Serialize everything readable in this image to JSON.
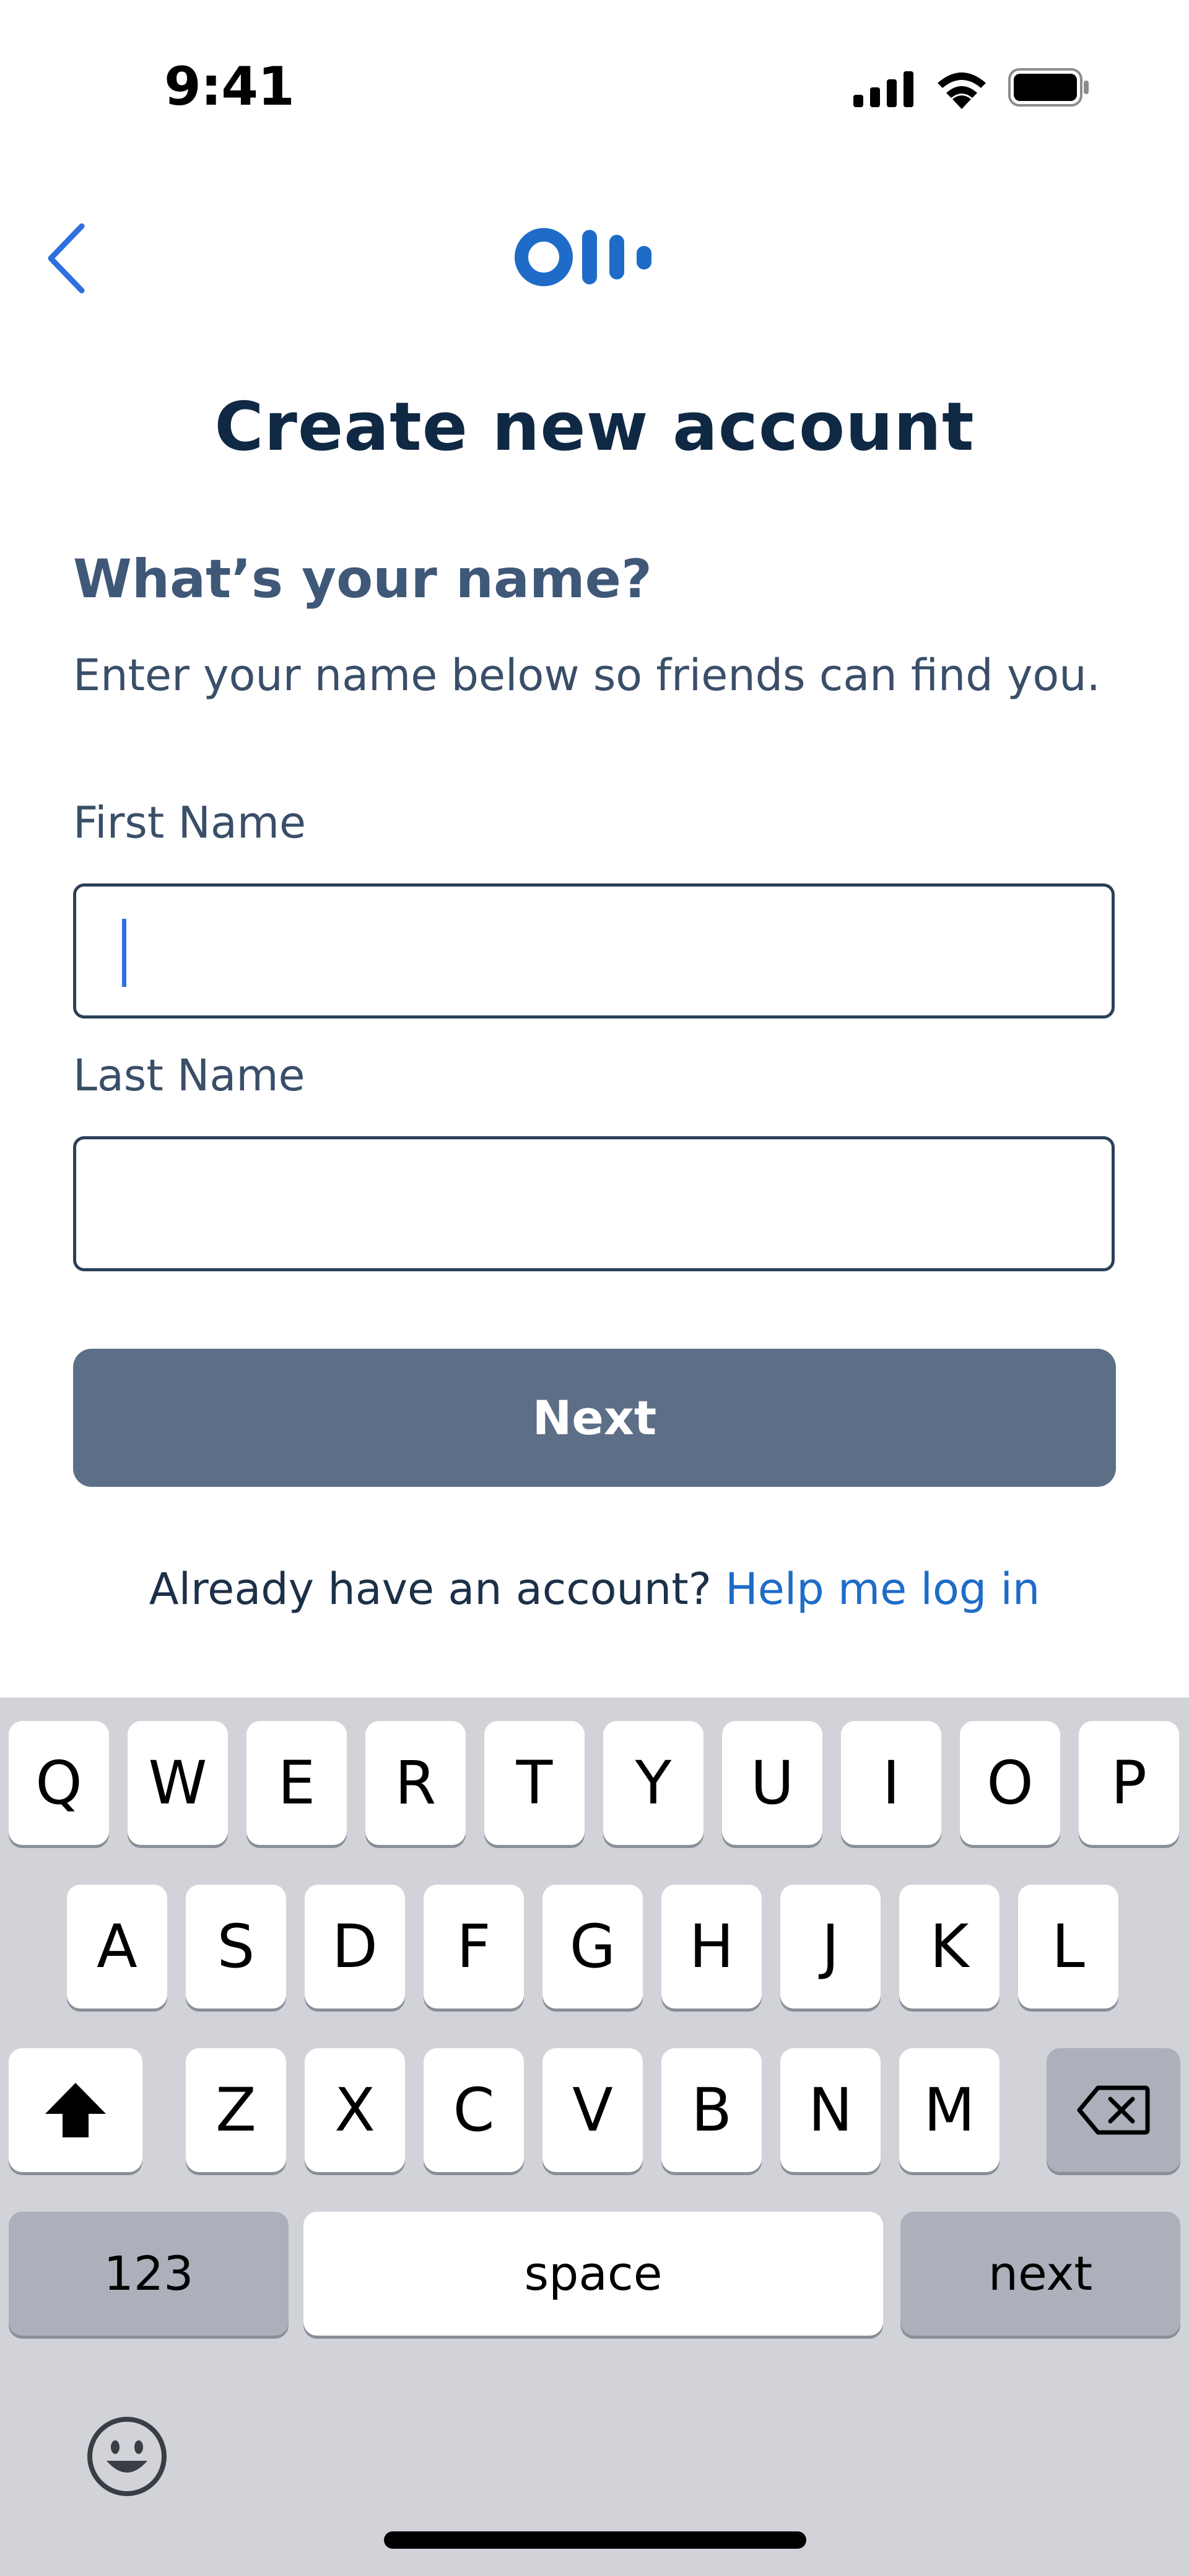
{
  "status_bar": {
    "time": "9:41"
  },
  "header": {
    "logo": "Otter logo"
  },
  "title": "Create new account",
  "question": "What’s your name?",
  "subtitle": "Enter your name below so friends can find you.",
  "form": {
    "first_name_label": "First Name",
    "first_name_value": "",
    "last_name_label": "Last Name",
    "last_name_value": ""
  },
  "next_button": "Next",
  "footer": {
    "text": "Already have an account? ",
    "link": "Help me log in"
  },
  "keyboard": {
    "row1": [
      "Q",
      "W",
      "E",
      "R",
      "T",
      "Y",
      "U",
      "I",
      "O",
      "P"
    ],
    "row2": [
      "A",
      "S",
      "D",
      "F",
      "G",
      "H",
      "J",
      "K",
      "L"
    ],
    "row3": [
      "Z",
      "X",
      "C",
      "V",
      "B",
      "N",
      "M"
    ],
    "numbers_key": "123",
    "space_key": "space",
    "return_key": "next"
  },
  "colors": {
    "accent": "#1e6cc8",
    "title": "#0f2844",
    "button": "#5c6f86",
    "keyboard_bg": "#d1d3d9"
  }
}
